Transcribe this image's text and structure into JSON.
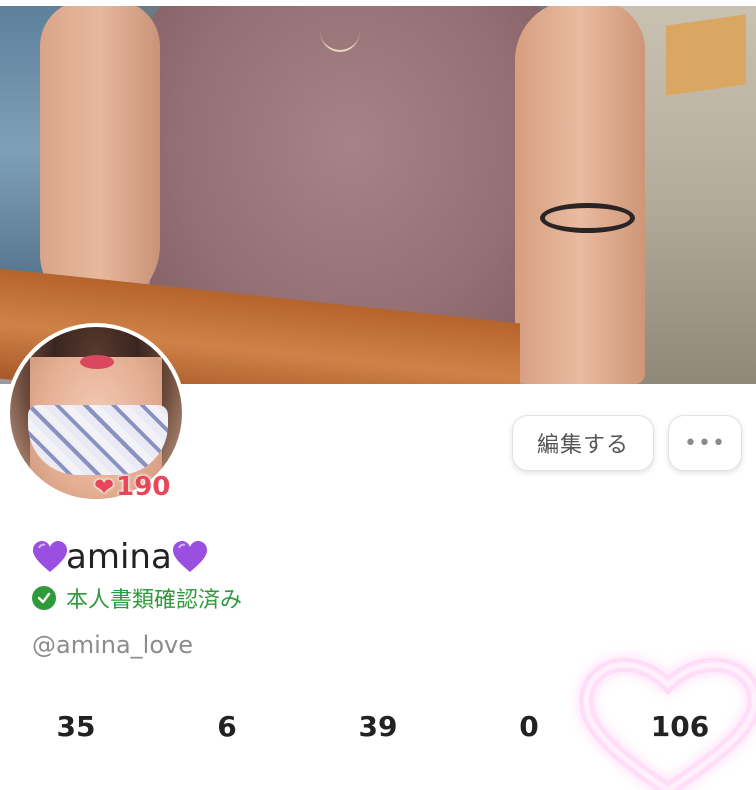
{
  "profile": {
    "display_name": "amina",
    "name_emoji": "purple-heart",
    "verified_label": "本人書類確認済み",
    "handle": "@amina_love",
    "likes_count": "190"
  },
  "actions": {
    "edit_label": "編集する",
    "more_label": "•••"
  },
  "stats": [
    "35",
    "6",
    "39",
    "0",
    "106"
  ],
  "icons": {
    "verified": "check-circle-icon",
    "likes": "heart-icon",
    "more": "more-icon",
    "decor": "neon-heart-icon"
  },
  "colors": {
    "verified_green": "#2f9a3a",
    "likes_red": "#e8475a",
    "name_heart_purple": "#9b4fe0",
    "neon_pink": "#ff7de0"
  }
}
